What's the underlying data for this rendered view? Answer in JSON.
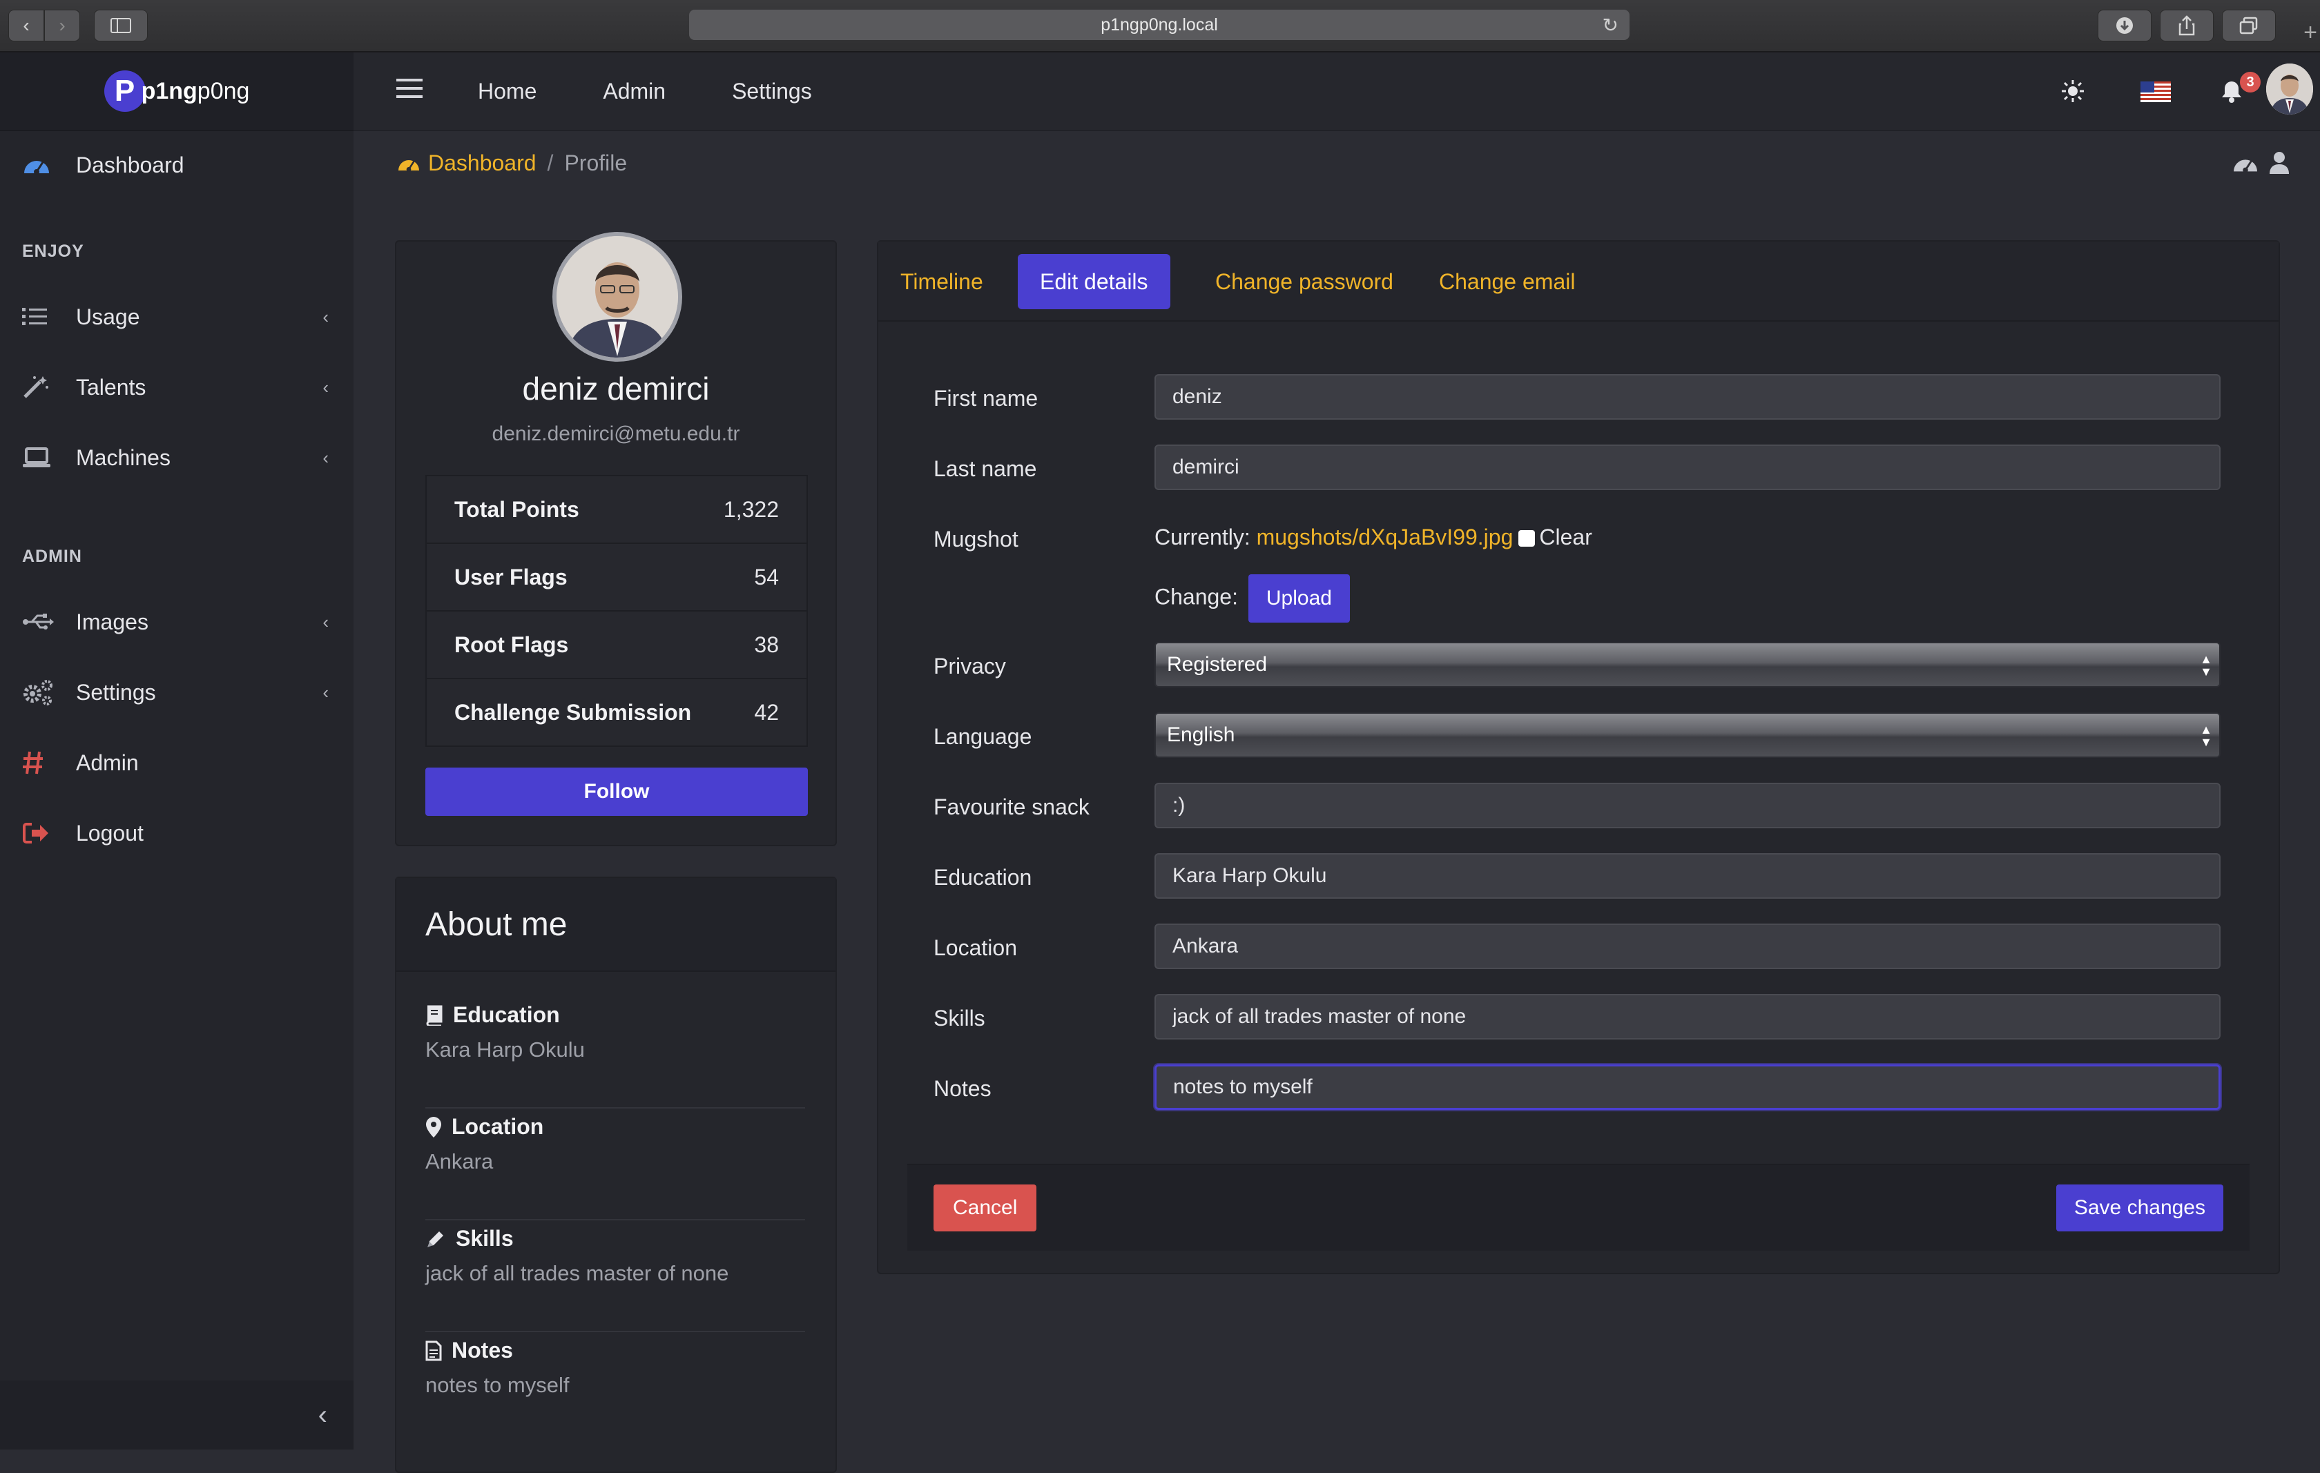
{
  "browser": {
    "url": "p1ngp0ng.local"
  },
  "brand": {
    "logo_letter": "P",
    "name_bold": "p1ng",
    "name_rest": "p0ng"
  },
  "sidebar": {
    "dashboard": "Dashboard",
    "section_enjoy": "ENJOY",
    "usage": "Usage",
    "talents": "Talents",
    "machines": "Machines",
    "section_admin": "ADMIN",
    "images": "Images",
    "settings": "Settings",
    "admin": "Admin",
    "logout": "Logout"
  },
  "topnav": {
    "home": "Home",
    "admin": "Admin",
    "settings": "Settings",
    "notification_count": "3"
  },
  "breadcrumb": {
    "dashboard": "Dashboard",
    "separator": "/",
    "current": "Profile"
  },
  "profile": {
    "name": "deniz demirci",
    "email": "deniz.demirci@metu.edu.tr",
    "stats": [
      {
        "label": "Total Points",
        "value": "1,322"
      },
      {
        "label": "User Flags",
        "value": "54"
      },
      {
        "label": "Root Flags",
        "value": "38"
      },
      {
        "label": "Challenge Submission",
        "value": "42"
      }
    ],
    "follow_label": "Follow"
  },
  "about": {
    "title": "About me",
    "education_label": "Education",
    "education": "Kara Harp Okulu",
    "location_label": "Location",
    "location": "Ankara",
    "skills_label": "Skills",
    "skills": "jack of all trades master of none",
    "notes_label": "Notes",
    "notes": "notes to myself"
  },
  "tabs": {
    "timeline": "Timeline",
    "edit_details": "Edit details",
    "change_password": "Change password",
    "change_email": "Change email"
  },
  "form": {
    "first_name_label": "First name",
    "first_name": "deniz",
    "last_name_label": "Last name",
    "last_name": "demirci",
    "mugshot_label": "Mugshot",
    "currently_label": "Currently:",
    "mugshot_file": "mugshots/dXqJaBvI99.jpg",
    "clear_label": "Clear",
    "change_label": "Change:",
    "upload_label": "Upload",
    "privacy_label": "Privacy",
    "privacy_value": "Registered",
    "language_label": "Language",
    "language_value": "English",
    "snack_label": "Favourite snack",
    "snack": ":)",
    "education_label": "Education",
    "education": "Kara Harp Okulu",
    "location_label": "Location",
    "location": "Ankara",
    "skills_label": "Skills",
    "skills": "jack of all trades master of none",
    "notes_label": "Notes",
    "notes": "notes to myself",
    "cancel_label": "Cancel",
    "save_label": "Save changes"
  }
}
